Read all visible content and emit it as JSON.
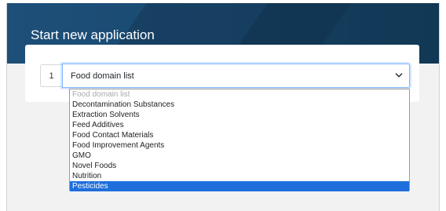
{
  "page": {
    "title": "Start new application"
  },
  "form": {
    "step_number": "1",
    "select": {
      "selected_value": "Food domain list",
      "options": [
        "Food domain list",
        "Decontamination Substances",
        "Extraction Solvents",
        "Feed Additives",
        "Food Contact Materials",
        "Food Improvement Agents",
        "GMO",
        "Novel Foods",
        "Nutrition",
        "Pesticides"
      ],
      "disabled_option": "Food domain list",
      "highlighted_option": "Pesticides"
    }
  },
  "colors": {
    "banner": "#1d4f78",
    "highlight": "#1e6fdc",
    "focus_border": "#86b7fe"
  },
  "icons": {
    "select_arrow": "chevron-down-icon"
  }
}
